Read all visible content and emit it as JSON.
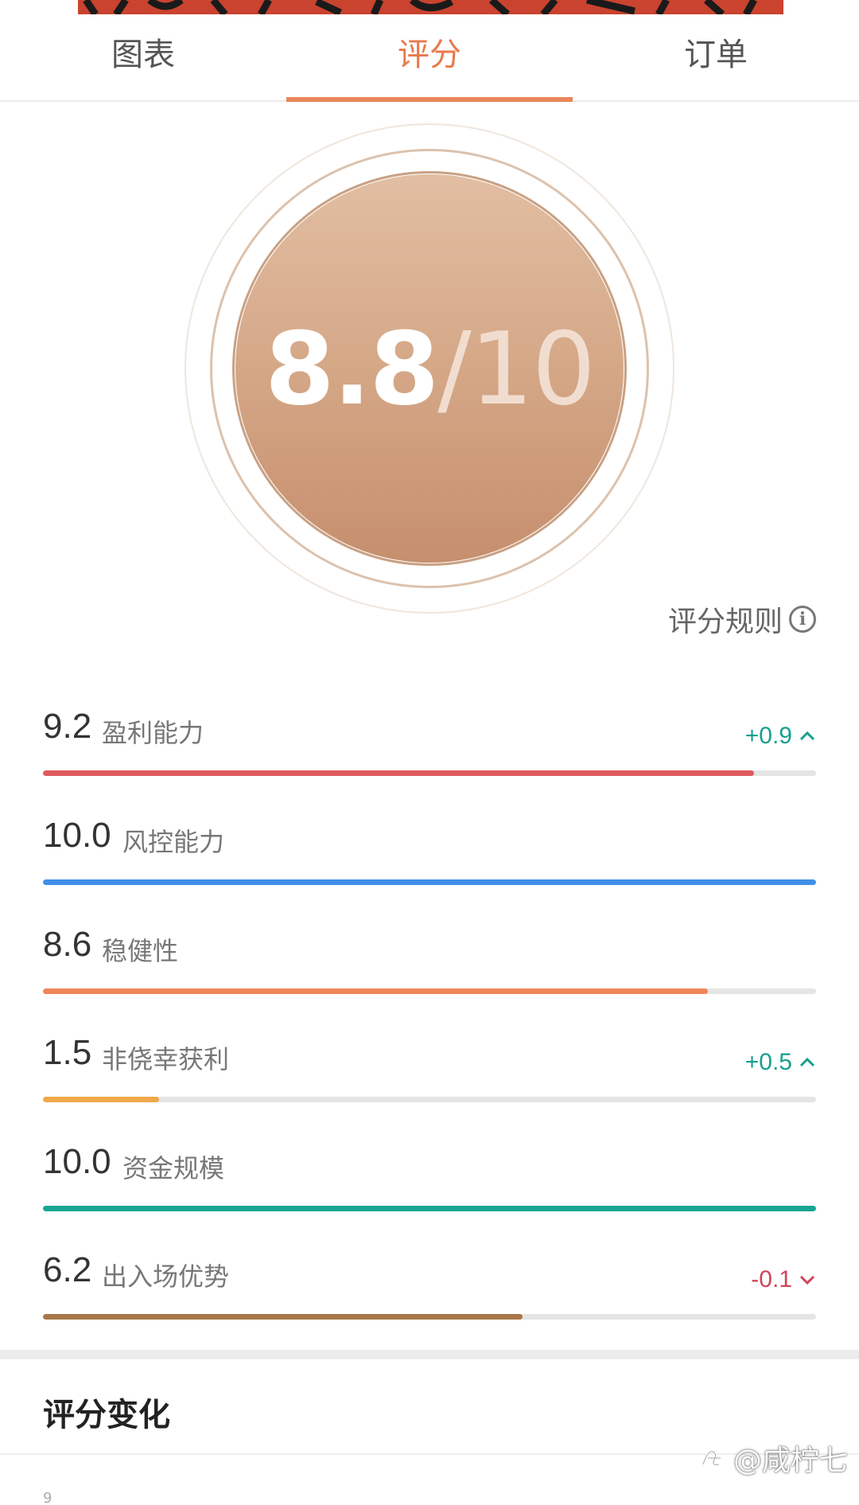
{
  "tabs": [
    {
      "label": "图表",
      "active": false
    },
    {
      "label": "评分",
      "active": true
    },
    {
      "label": "订单",
      "active": false
    }
  ],
  "score": {
    "value": "8.8",
    "separator": "/",
    "max": "10"
  },
  "rules_label": "评分规则",
  "metrics": [
    {
      "value": "9.2",
      "label": "盈利能力",
      "change": "+0.9",
      "direction": "up",
      "fill": 0.92,
      "color": "#e05a5e"
    },
    {
      "value": "10.0",
      "label": "风控能力",
      "change": "",
      "direction": "",
      "fill": 1.0,
      "color": "#3f8fe8"
    },
    {
      "value": "8.6",
      "label": "稳健性",
      "change": "",
      "direction": "",
      "fill": 0.86,
      "color": "#ef8558"
    },
    {
      "value": "1.5",
      "label": "非侥幸获利",
      "change": "+0.5",
      "direction": "up",
      "fill": 0.15,
      "color": "#efa84a"
    },
    {
      "value": "10.0",
      "label": "资金规模",
      "change": "",
      "direction": "",
      "fill": 1.0,
      "color": "#17a592"
    },
    {
      "value": "6.2",
      "label": "出入场优势",
      "change": "-0.1",
      "direction": "down",
      "fill": 0.62,
      "color": "#a87748"
    }
  ],
  "section_title": "评分变化",
  "chart_axis_tick": "9",
  "watermark": "@咸柠七",
  "colors": {
    "accent": "#e87a4c",
    "up": "#14a08c",
    "down": "#d0445a"
  }
}
